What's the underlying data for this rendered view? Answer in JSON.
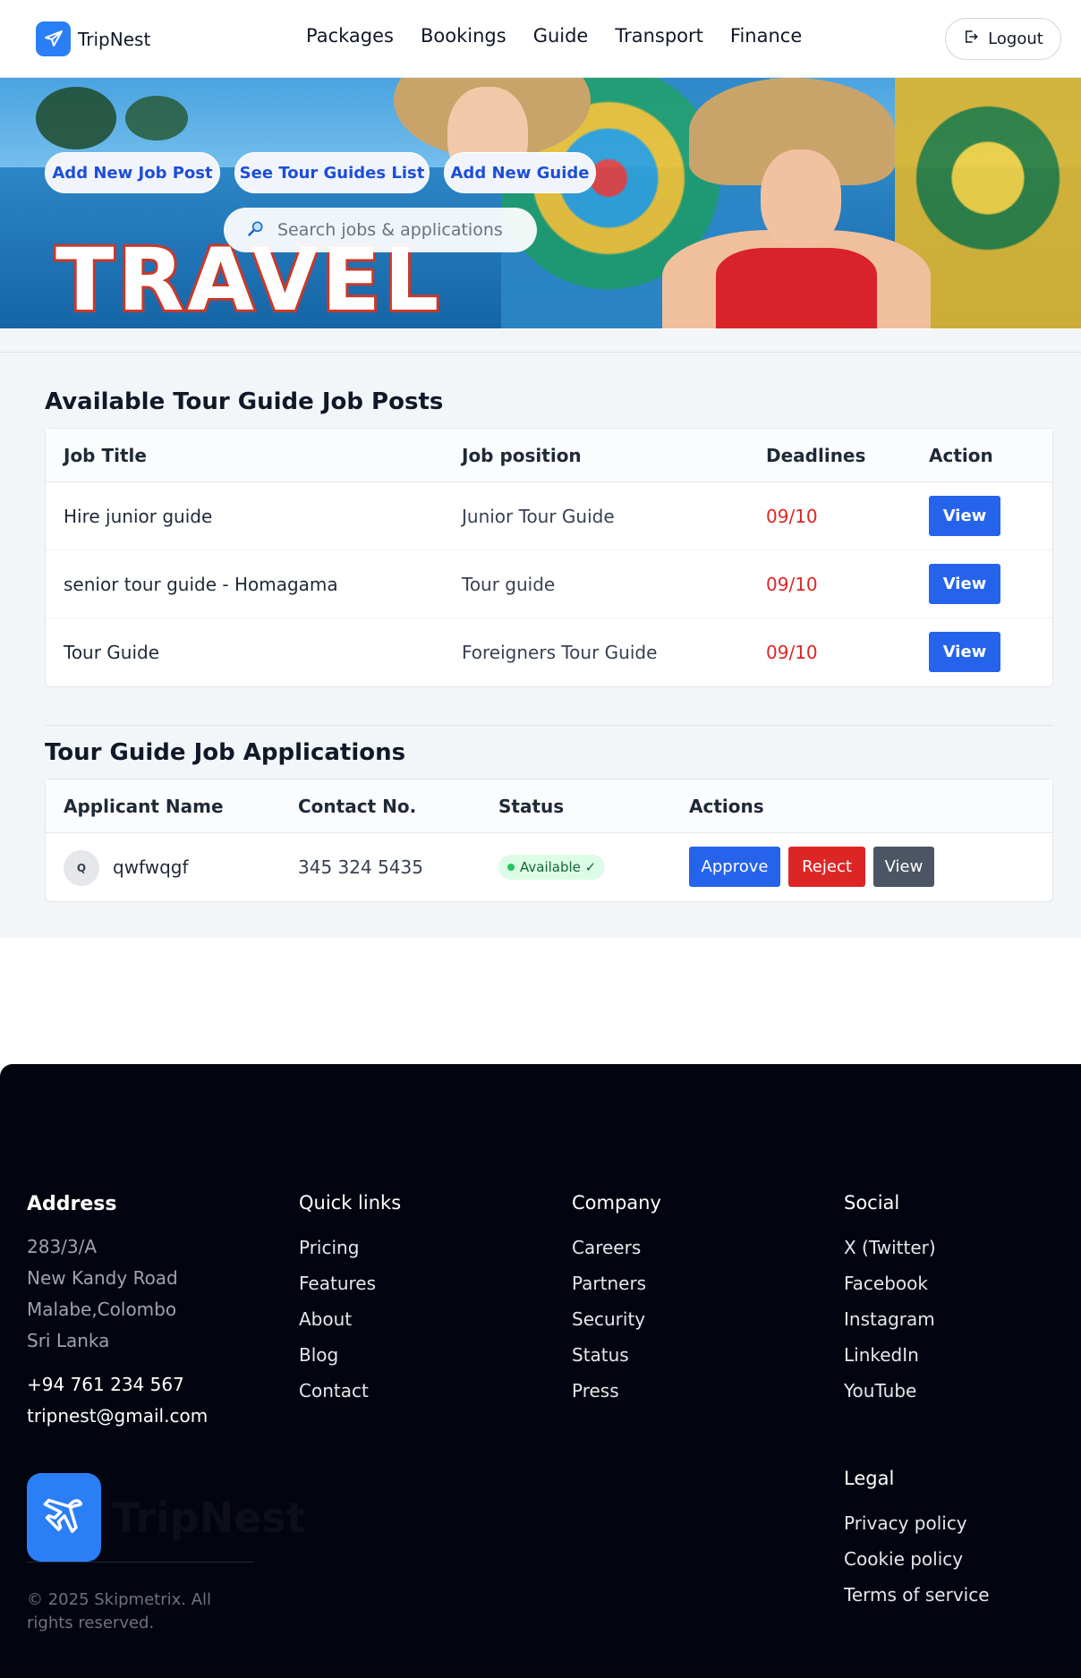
{
  "brand": {
    "name": "TripNest"
  },
  "nav": [
    "Packages",
    "Bookings",
    "Guide",
    "Transport",
    "Finance"
  ],
  "header": {
    "logout_label": "Logout"
  },
  "hero": {
    "banner_text": "TRAVEL",
    "buttons": [
      "Add New Job Post",
      "See Tour Guides List",
      "Add New Guide"
    ],
    "search_placeholder": "Search jobs & applications"
  },
  "jobs": {
    "title": "Available Tour Guide Job Posts",
    "columns": [
      "Job Title",
      "Job position",
      "Deadlines",
      "Action"
    ],
    "rows": [
      {
        "title": "Hire junior guide",
        "position": "Junior Tour Guide",
        "deadline": "09/10",
        "action": "View"
      },
      {
        "title": "senior tour guide - Homagama",
        "position": "Tour guide",
        "deadline": "09/10",
        "action": "View"
      },
      {
        "title": "Tour Guide",
        "position": "Foreigners Tour Guide",
        "deadline": "09/10",
        "action": "View"
      }
    ]
  },
  "applications": {
    "title": "Tour Guide Job Applications",
    "columns": [
      "Applicant Name",
      "Contact No.",
      "Status",
      "Actions"
    ],
    "rows": [
      {
        "initial": "Q",
        "name": "qwfwqgf",
        "contact": "345 324 5435",
        "status": "Available ✓",
        "approve": "Approve",
        "reject": "Reject",
        "view": "View"
      }
    ]
  },
  "footer": {
    "address_title": "Address",
    "address_lines": [
      "283/3/A",
      "New Kandy Road",
      "Malabe,Colombo",
      "Sri Lanka"
    ],
    "phone": "+94 761 234 567",
    "email": "tripnest@gmail.com",
    "quick_links_title": "Quick links",
    "quick_links": [
      "Pricing",
      "Features",
      "About",
      "Blog",
      "Contact"
    ],
    "company_title": "Company",
    "company_links": [
      "Careers",
      "Partners",
      "Security",
      "Status",
      "Press"
    ],
    "social_title": "Social",
    "social_links": [
      "X (Twitter)",
      "Facebook",
      "Instagram",
      "LinkedIn",
      "YouTube"
    ],
    "legal_title": "Legal",
    "legal_links": [
      "Privacy policy",
      "Cookie policy",
      "Terms of service"
    ],
    "logo_name": "TripNest",
    "copyright": "© 2025 Skipmetrix. All rights reserved."
  },
  "colors": {
    "primary": "#2563eb",
    "danger": "#dc2626",
    "neutral_button": "#4b5563",
    "footer_bg": "#02040f",
    "brand_icon": "#2b7ff6"
  },
  "icons": [
    "airplane-icon",
    "logout-icon",
    "search-icon"
  ]
}
